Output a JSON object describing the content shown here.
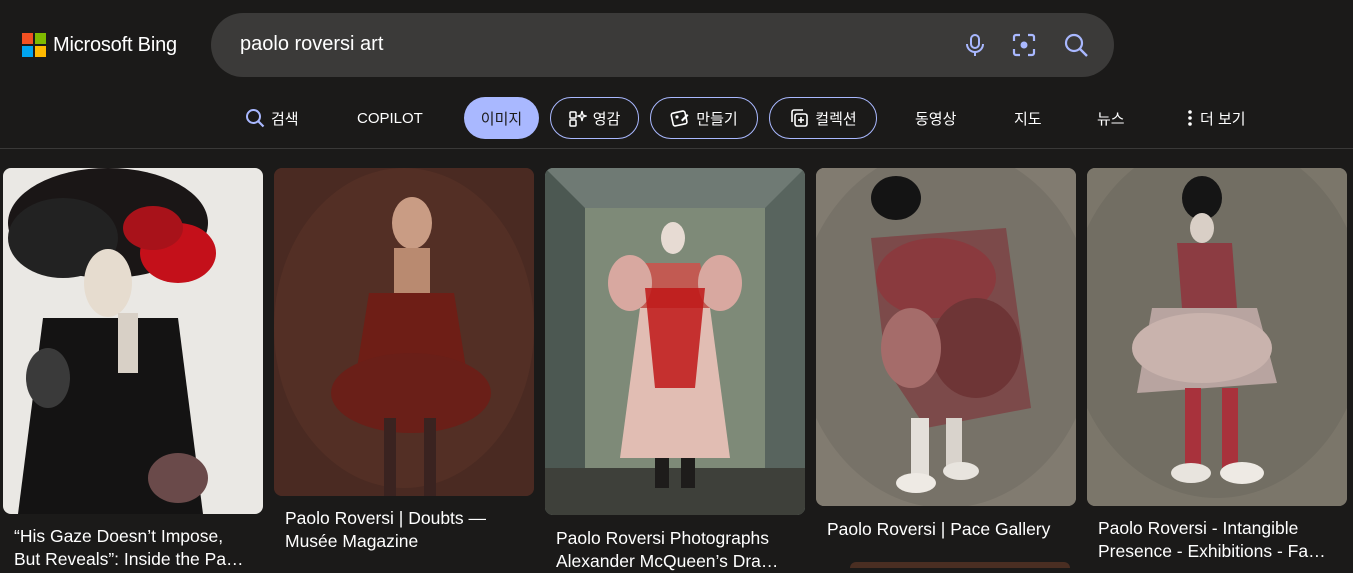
{
  "brand": {
    "name": "Microsoft Bing",
    "colors": [
      "#f25022",
      "#7fba00",
      "#00a4ef",
      "#ffb900"
    ]
  },
  "search": {
    "query": "paolo roversi art",
    "icons": [
      "microphone-icon",
      "visual-search-icon",
      "search-icon"
    ]
  },
  "tabs": [
    {
      "label": "검색",
      "icon": "search-icon"
    },
    {
      "label": "COPILOT"
    },
    {
      "label": "이미지",
      "active": true
    },
    {
      "label": "영감",
      "icon": "sparkle-icon"
    },
    {
      "label": "만들기",
      "icon": "image-create-icon"
    },
    {
      "label": "컬렉션",
      "icon": "collection-icon"
    },
    {
      "label": "동영상"
    },
    {
      "label": "지도"
    },
    {
      "label": "뉴스"
    },
    {
      "label": "더 보기",
      "icon": "more-vertical-icon"
    }
  ],
  "results": [
    {
      "caption_line1": "“His Gaze Doesn’t Impose,",
      "caption_line2": "But Reveals”: Inside the Pa…"
    },
    {
      "caption_line1": "Paolo Roversi | Doubts —",
      "caption_line2": "Musée Magazine"
    },
    {
      "caption_line1": "Paolo Roversi Photographs",
      "caption_line2": "Alexander McQueen’s Dra…"
    },
    {
      "caption_line1": "Paolo Roversi | Pace Gallery",
      "caption_line2": ""
    },
    {
      "caption_line1": "Paolo Roversi - Intangible",
      "caption_line2": "Presence - Exhibitions - Fa…"
    }
  ]
}
